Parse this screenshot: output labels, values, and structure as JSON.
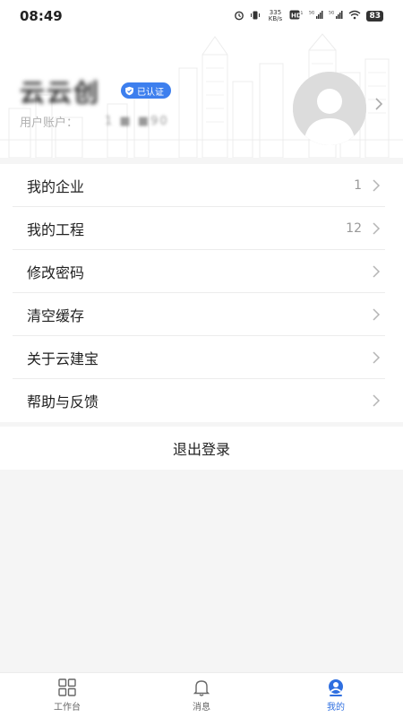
{
  "status_bar": {
    "time": "08:49",
    "speed": "335 KB/s",
    "battery": "83"
  },
  "profile": {
    "name": "云云创",
    "verified_label": "已认证",
    "account_label": "用户账户：",
    "account_value": "1  ■ ■90"
  },
  "menu": {
    "items": [
      {
        "label": "我的企业",
        "count": "1"
      },
      {
        "label": "我的工程",
        "count": "12"
      },
      {
        "label": "修改密码",
        "count": ""
      },
      {
        "label": "清空缓存",
        "count": ""
      },
      {
        "label": "关于云建宝",
        "count": ""
      },
      {
        "label": "帮助与反馈",
        "count": ""
      }
    ]
  },
  "logout_label": "退出登录",
  "tabbar": {
    "tabs": [
      {
        "label": "工作台",
        "icon": "grid-icon"
      },
      {
        "label": "消息",
        "icon": "bell-icon"
      },
      {
        "label": "我的",
        "icon": "user-icon"
      }
    ],
    "active_color": "#2f6fe0"
  }
}
